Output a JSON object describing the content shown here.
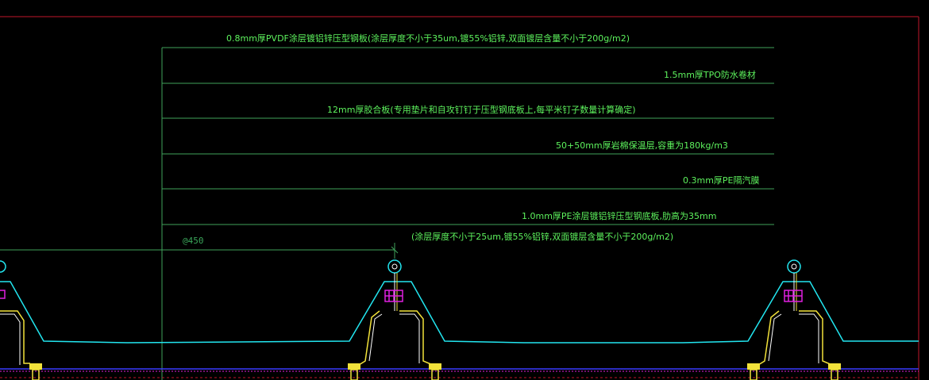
{
  "colors": {
    "background": "#000000",
    "leader_line": "#3fa25a",
    "annotation_text": "#5df25d",
    "frame_border": "#c0162a",
    "profile_outline": "#22e6f0",
    "bracket": "#f2e23a",
    "bolt": "#f2e23a",
    "washer_magenta": "#e020e0",
    "base_line": "#3a3aff"
  },
  "annotations": [
    {
      "id": "layer-1",
      "text": "0.8mm厚PVDF涂层镀铝锌压型钢板(涂层厚度不小于35um,镀55%铝锌,双面镀层含量不小于200g/m2)"
    },
    {
      "id": "layer-2",
      "text": "1.5mm厚TPO防水卷材"
    },
    {
      "id": "layer-3",
      "text": "12mm厚胶合板(专用垫片和自攻钉钉于压型钢底板上,每平米钉子数量计算确定)"
    },
    {
      "id": "layer-4",
      "text": "50+50mm厚岩棉保温层,容重为180kg/m3"
    },
    {
      "id": "layer-5",
      "text": "0.3mm厚PE隔汽膜"
    },
    {
      "id": "layer-6",
      "text": "1.0mm厚PE涂层镀铝锌压型钢底板,肋高为35mm"
    },
    {
      "id": "layer-6b",
      "text": "(涂层厚度不小于25um,镀55%铝锌,双面镀层含量不小于200g/m2)"
    }
  ],
  "dimension": {
    "label": "@450"
  },
  "icons": {
    "seam-clip": "seam-clip-icon",
    "bolt": "bolt-icon"
  }
}
